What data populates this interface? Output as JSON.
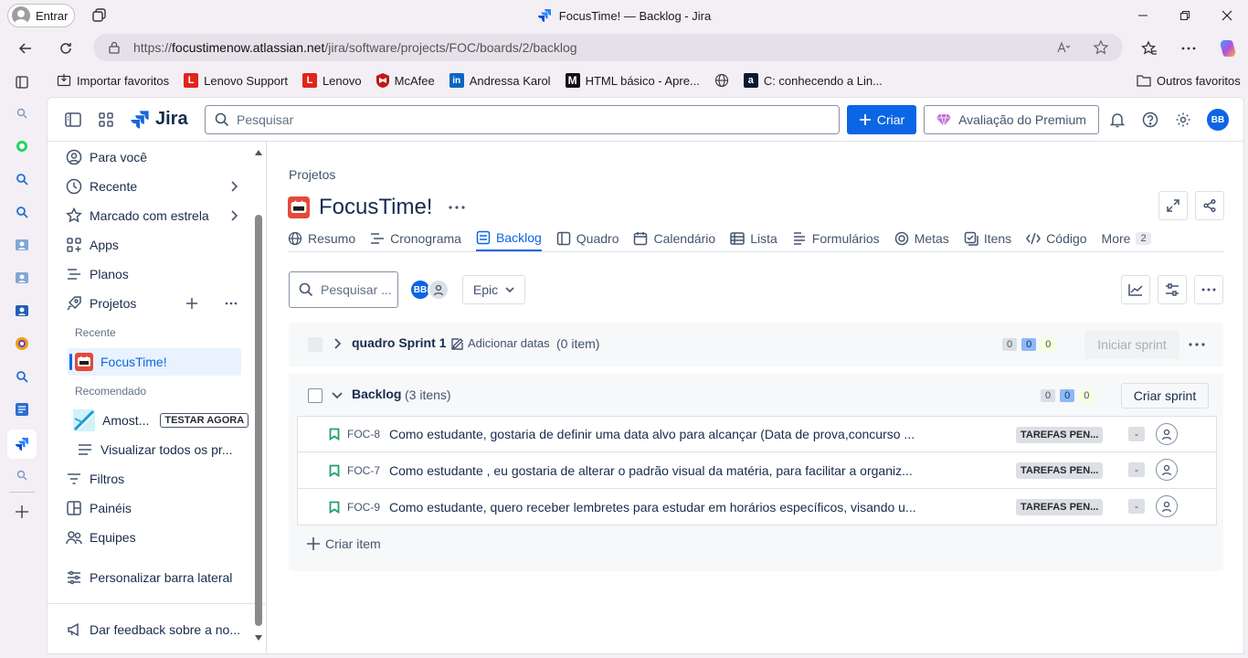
{
  "browser": {
    "profile_label": "Entrar",
    "window_title": "FocusTime! — Backlog - Jira",
    "url_prefix": "https://",
    "url_host": "focustimenow.atlassian.net",
    "url_path": "/jira/software/projects/FOC/boards/2/backlog",
    "bookmarks": [
      {
        "label": "Importar favoritos",
        "icon": "import-icon"
      },
      {
        "label": "Lenovo Support",
        "icon": "lenovo-icon"
      },
      {
        "label": "Lenovo",
        "icon": "lenovo-icon"
      },
      {
        "label": "McAfee",
        "icon": "mcafee-icon"
      },
      {
        "label": "Andressa Karol",
        "icon": "linkedin-icon"
      },
      {
        "label": "HTML básico - Apre...",
        "icon": "mdn-icon"
      },
      {
        "label": "",
        "icon": "globe-icon"
      },
      {
        "label": "C: conhecendo a Lin...",
        "icon": "alura-icon"
      }
    ],
    "other_favorites": "Outros favoritos"
  },
  "topbar": {
    "brand": "Jira",
    "search_placeholder": "Pesquisar",
    "create_label": "Criar",
    "premium_label": "Avaliação do Premium",
    "avatar_initials": "BB"
  },
  "sidebar": {
    "items_top": [
      {
        "label": "Para você",
        "icon": "user-circle-icon"
      },
      {
        "label": "Recente",
        "icon": "clock-icon"
      },
      {
        "label": "Marcado com estrela",
        "icon": "star-icon"
      },
      {
        "label": "Apps",
        "icon": "apps-icon"
      },
      {
        "label": "Planos",
        "icon": "plans-icon"
      },
      {
        "label": "Projetos",
        "icon": "rocket-icon"
      }
    ],
    "recent_heading": "Recente",
    "recent_project": "FocusTime!",
    "recommended_heading": "Recomendado",
    "recommended_item": "Amost...",
    "try_now": "TESTAR AGORA",
    "view_all": "Visualizar todos os pr...",
    "items_bottom": [
      {
        "label": "Filtros",
        "icon": "filter-icon"
      },
      {
        "label": "Painéis",
        "icon": "dashboard-icon"
      },
      {
        "label": "Equipes",
        "icon": "teams-icon"
      }
    ],
    "customize": "Personalizar barra lateral",
    "feedback": "Dar feedback sobre a no..."
  },
  "main": {
    "breadcrumb": "Projetos",
    "project_title": "FocusTime!",
    "tabs": [
      {
        "label": "Resumo",
        "icon": "globe-icon",
        "active": false
      },
      {
        "label": "Cronograma",
        "icon": "timeline-icon",
        "active": false
      },
      {
        "label": "Backlog",
        "icon": "backlog-icon",
        "active": true
      },
      {
        "label": "Quadro",
        "icon": "board-icon",
        "active": false
      },
      {
        "label": "Calendário",
        "icon": "calendar-icon",
        "active": false
      },
      {
        "label": "Lista",
        "icon": "list-icon",
        "active": false
      },
      {
        "label": "Formulários",
        "icon": "forms-icon",
        "active": false
      },
      {
        "label": "Metas",
        "icon": "target-icon",
        "active": false
      },
      {
        "label": "Itens",
        "icon": "items-icon",
        "active": false
      },
      {
        "label": "Código",
        "icon": "code-icon",
        "active": false
      }
    ],
    "more_label": "More",
    "more_count": "2",
    "backlog_search_placeholder": "Pesquisar ...",
    "epic_label": "Epic",
    "sprint": {
      "name": "quadro Sprint 1",
      "add_dates": "Adicionar datas",
      "count": "(0 item)",
      "todo": "0",
      "in_progress": "0",
      "done": "0",
      "start_label": "Iniciar sprint"
    },
    "backlog": {
      "name": "Backlog",
      "count": "(3 itens)",
      "todo": "0",
      "in_progress": "0",
      "done": "0",
      "create_sprint": "Criar sprint",
      "items": [
        {
          "key": "FOC-8",
          "summary": "Como estudante, gostaria de definir uma data alvo para alcançar (Data de prova,concurso ...",
          "status": "TAREFAS PEN...",
          "points": "-"
        },
        {
          "key": "FOC-7",
          "summary": "Como estudante , eu gostaria de alterar o padrão visual da matéria, para facilitar a organiz...",
          "status": "TAREFAS PEN...",
          "points": "-"
        },
        {
          "key": "FOC-9",
          "summary": "Como estudante, quero receber lembretes para estudar em horários específicos, visando u...",
          "status": "TAREFAS PEN...",
          "points": "-"
        }
      ],
      "create_item": "Criar item"
    }
  },
  "colors": {
    "accent": "#0c66e4",
    "project_icon": "#e5493a",
    "story_icon": "#22a06b",
    "chip_blue": "#cce0ff",
    "chip_green": "#dcfff1",
    "chip_gray": "#dcdfe4"
  }
}
